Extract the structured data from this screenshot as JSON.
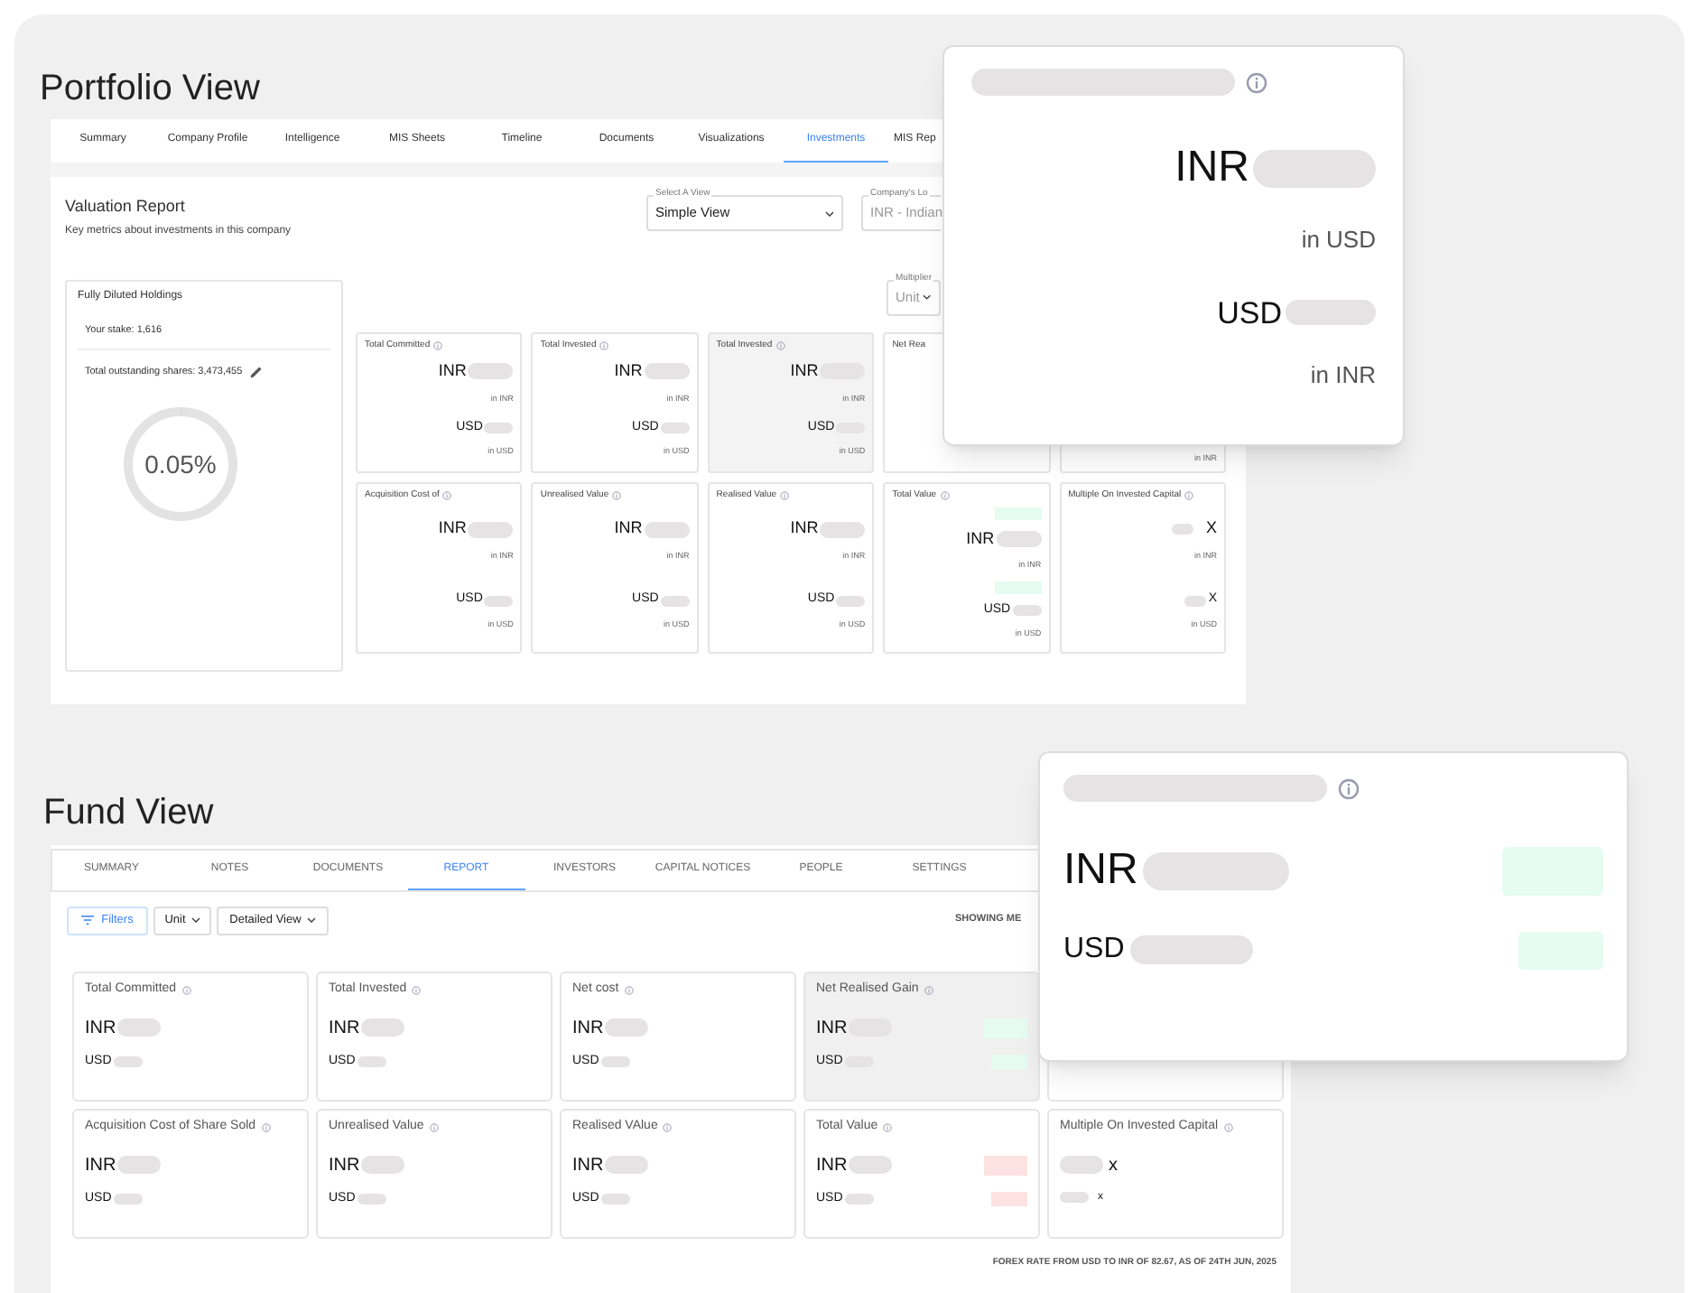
{
  "portfolio": {
    "heading": "Portfolio View",
    "tabs": [
      {
        "label": "Summary",
        "selected": false
      },
      {
        "label": "Company Profile",
        "selected": false
      },
      {
        "label": "Intelligence",
        "selected": false
      },
      {
        "label": "MIS Sheets",
        "selected": false
      },
      {
        "label": "Timeline",
        "selected": false
      },
      {
        "label": "Documents",
        "selected": false
      },
      {
        "label": "Visualizations",
        "selected": false
      },
      {
        "label": "Investments",
        "selected": true
      },
      {
        "label": "MIS Rep",
        "selected": false
      }
    ],
    "title": "Valuation Report",
    "subtitle": "Key metrics about investments in this company",
    "view_select": {
      "label": "Select A View",
      "value": "Simple View"
    },
    "currency_select": {
      "label": "Company's Lo",
      "value": "INR - Indian"
    },
    "multiplier_select": {
      "label": "Multiplier",
      "value": "Unit"
    },
    "holdings": {
      "title": "Fully Diluted Holdings",
      "stake": "Your stake: 1,616",
      "outstanding": "Total outstanding shares: 3,473,455",
      "percent": "0.05%",
      "level": 0.0005
    },
    "rows": [
      [
        {
          "label": "Total Committed",
          "highlighted": false,
          "lines": [
            {
              "currency": "INR",
              "note": "in INR"
            },
            {
              "currency": "USD",
              "note": "in USD"
            }
          ]
        },
        {
          "label": "Total Invested",
          "highlighted": false,
          "lines": [
            {
              "currency": "INR",
              "note": "in INR"
            },
            {
              "currency": "USD",
              "note": "in USD"
            }
          ]
        },
        {
          "label": "Total Invested",
          "highlighted": true,
          "lines": [
            {
              "currency": "INR",
              "note": "in INR"
            },
            {
              "currency": "USD",
              "note": "in USD"
            }
          ]
        },
        {
          "label": "Net Rea",
          "highlighted": false
        },
        {
          "highlighted": false,
          "lines": [
            {
              "note": "in INR"
            }
          ]
        }
      ],
      [
        {
          "label": "Acquisition Cost of",
          "highlighted": false,
          "lines": [
            {
              "currency": "INR",
              "note": "in INR"
            },
            {
              "currency": "USD",
              "note": "in USD"
            }
          ]
        },
        {
          "label": "Unrealised Value",
          "highlighted": false,
          "lines": [
            {
              "currency": "INR",
              "note": "in INR"
            },
            {
              "currency": "USD",
              "note": "in USD"
            }
          ]
        },
        {
          "label": "Realised Value",
          "highlighted": false,
          "lines": [
            {
              "currency": "INR",
              "note": "in INR"
            },
            {
              "currency": "USD",
              "note": "in USD"
            }
          ]
        },
        {
          "label": "Total Value",
          "highlighted": false,
          "lines": [
            {
              "currency": "INR",
              "note": "in INR",
              "color": "#e6fbf1"
            },
            {
              "currency": "USD",
              "note": "in USD",
              "color": "#e6fbf1"
            }
          ]
        },
        {
          "label": "Multiple On Invested Capital",
          "highlighted": false,
          "lines": [
            {
              "suffix": "X",
              "note": "in INR"
            },
            {
              "suffix": "X",
              "note": "in USD"
            }
          ]
        }
      ]
    ],
    "callout": {
      "lines": [
        {
          "currency": "INR",
          "note": "in USD"
        },
        {
          "currency": "USD",
          "note": "in INR"
        }
      ]
    }
  },
  "fund": {
    "heading": "Fund View",
    "tabs": [
      {
        "label": "SUMMARY",
        "selected": false
      },
      {
        "label": "NOTES",
        "selected": false
      },
      {
        "label": "DOCUMENTS",
        "selected": false
      },
      {
        "label": "REPORT",
        "selected": true
      },
      {
        "label": "INVESTORS",
        "selected": false
      },
      {
        "label": "CAPITAL NOTICES",
        "selected": false
      },
      {
        "label": "PEOPLE",
        "selected": false
      },
      {
        "label": "SETTINGS",
        "selected": false
      }
    ],
    "filters_button": "Filters",
    "unit_select": "Unit",
    "view_select": "Detailed View",
    "showing_label": "SHOWING ME",
    "rows": [
      [
        {
          "label": "Total Committed",
          "highlighted": false,
          "lines": [
            {
              "currency": "INR"
            },
            {
              "currency": "USD"
            }
          ]
        },
        {
          "label": "Total Invested",
          "highlighted": false,
          "lines": [
            {
              "currency": "INR"
            },
            {
              "currency": "USD"
            }
          ]
        },
        {
          "label": "Net cost",
          "highlighted": false,
          "lines": [
            {
              "currency": "INR"
            },
            {
              "currency": "USD"
            }
          ]
        },
        {
          "label": "Net Realised Gain",
          "highlighted": true,
          "lines": [
            {
              "currency": "INR",
              "color": "#e6fbf1"
            },
            {
              "currency": "USD",
              "color": "#e6fbf1"
            }
          ]
        }
      ],
      [
        {
          "label": "Acquisition Cost of Share Sold",
          "highlighted": false,
          "lines": [
            {
              "currency": "INR"
            },
            {
              "currency": "USD"
            }
          ]
        },
        {
          "label": "Unrealised Value",
          "highlighted": false,
          "lines": [
            {
              "currency": "INR"
            },
            {
              "currency": "USD"
            }
          ]
        },
        {
          "label": "Realised VAlue",
          "highlighted": false,
          "lines": [
            {
              "currency": "INR"
            },
            {
              "currency": "USD"
            }
          ]
        },
        {
          "label": "Total Value",
          "highlighted": false,
          "lines": [
            {
              "currency": "INR",
              "color": "#fde2e2"
            },
            {
              "currency": "USD",
              "color": "#fde2e2"
            }
          ]
        },
        {
          "label": "Multiple On Invested Capital",
          "highlighted": false,
          "lines": [
            {
              "suffix": "x"
            },
            {
              "suffix": "x"
            }
          ]
        }
      ]
    ],
    "footnote": "FOREX RATE FROM USD TO INR OF **82.67**,  AS OF 24TH JUN, 2025",
    "callout": {
      "lines": [
        {
          "currency": "INR",
          "color": "#e6fbf1"
        },
        {
          "currency": "USD",
          "color": "#e6fbf1"
        }
      ]
    }
  }
}
